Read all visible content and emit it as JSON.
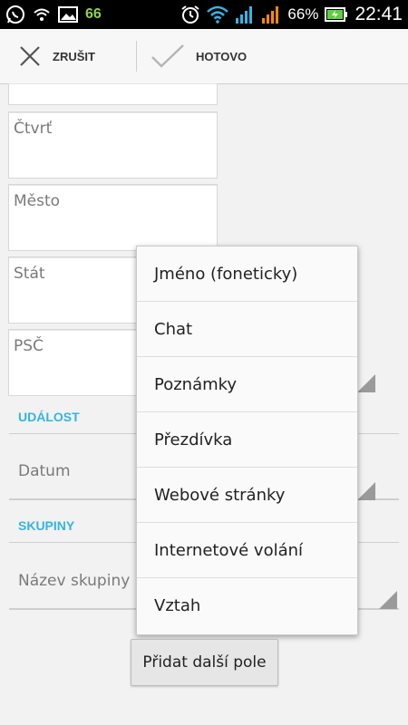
{
  "status_bar": {
    "icons": [
      "whatsapp-icon",
      "wifi-small-icon",
      "image-icon",
      "alarm-icon",
      "wifi-icon",
      "signal-blue-icon",
      "signal-orange-icon",
      "battery-charging-icon"
    ],
    "notification_count": "66",
    "battery_percent": "66%",
    "time": "22:41"
  },
  "action_bar": {
    "cancel_label": "ZRUŠIT",
    "done_label": "HOTOVO"
  },
  "form": {
    "fields": {
      "district_placeholder": "Čtvrť",
      "city_placeholder": "Město",
      "state_placeholder": "Stát",
      "zip_placeholder": "PSČ"
    },
    "sections": {
      "event_header": "UDÁLOST",
      "groups_header": "SKUPINY"
    },
    "date_label": "Datum",
    "group_name_label": "Název skupiny"
  },
  "popup_menu": {
    "items": [
      "Jméno (foneticky)",
      "Chat",
      "Poznámky",
      "Přezdívka",
      "Webové stránky",
      "Internetové volání",
      "Vztah"
    ]
  },
  "add_field_button": "Přidat další pole",
  "colors": {
    "accent": "#33b5e5",
    "status_bar_bg": "#000000",
    "signal_blue": "#33b5e5",
    "signal_orange": "#ff8a00",
    "count_green": "#8fd14f"
  }
}
